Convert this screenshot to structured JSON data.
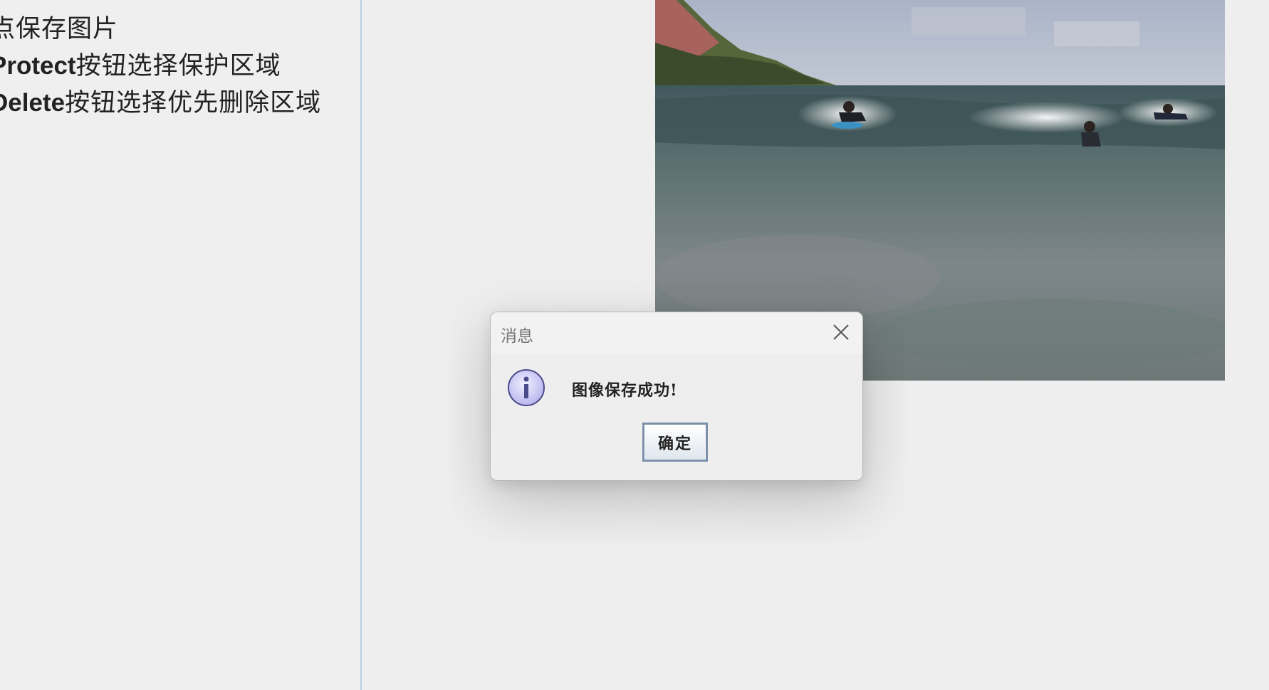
{
  "instructions": {
    "line1": "点保存图片",
    "line2_bold": "Protect",
    "line2_rest": "按钮选择保护区域",
    "line3_bold": "Delete",
    "line3_rest": "按钮选择优先删除区域"
  },
  "dialog": {
    "title": "消息",
    "message": "图像保存成功!",
    "ok_label": "确定",
    "icon": "info-icon",
    "close_icon": "close-icon"
  },
  "photo": {
    "subject": "surfers-on-waves"
  },
  "colors": {
    "background": "#eeeeee",
    "panel_divider": "#b8cfe6",
    "dialog_border": "#b9b9b9",
    "button_border": "#7a8fa8",
    "info_icon": "#c9c7f2"
  }
}
